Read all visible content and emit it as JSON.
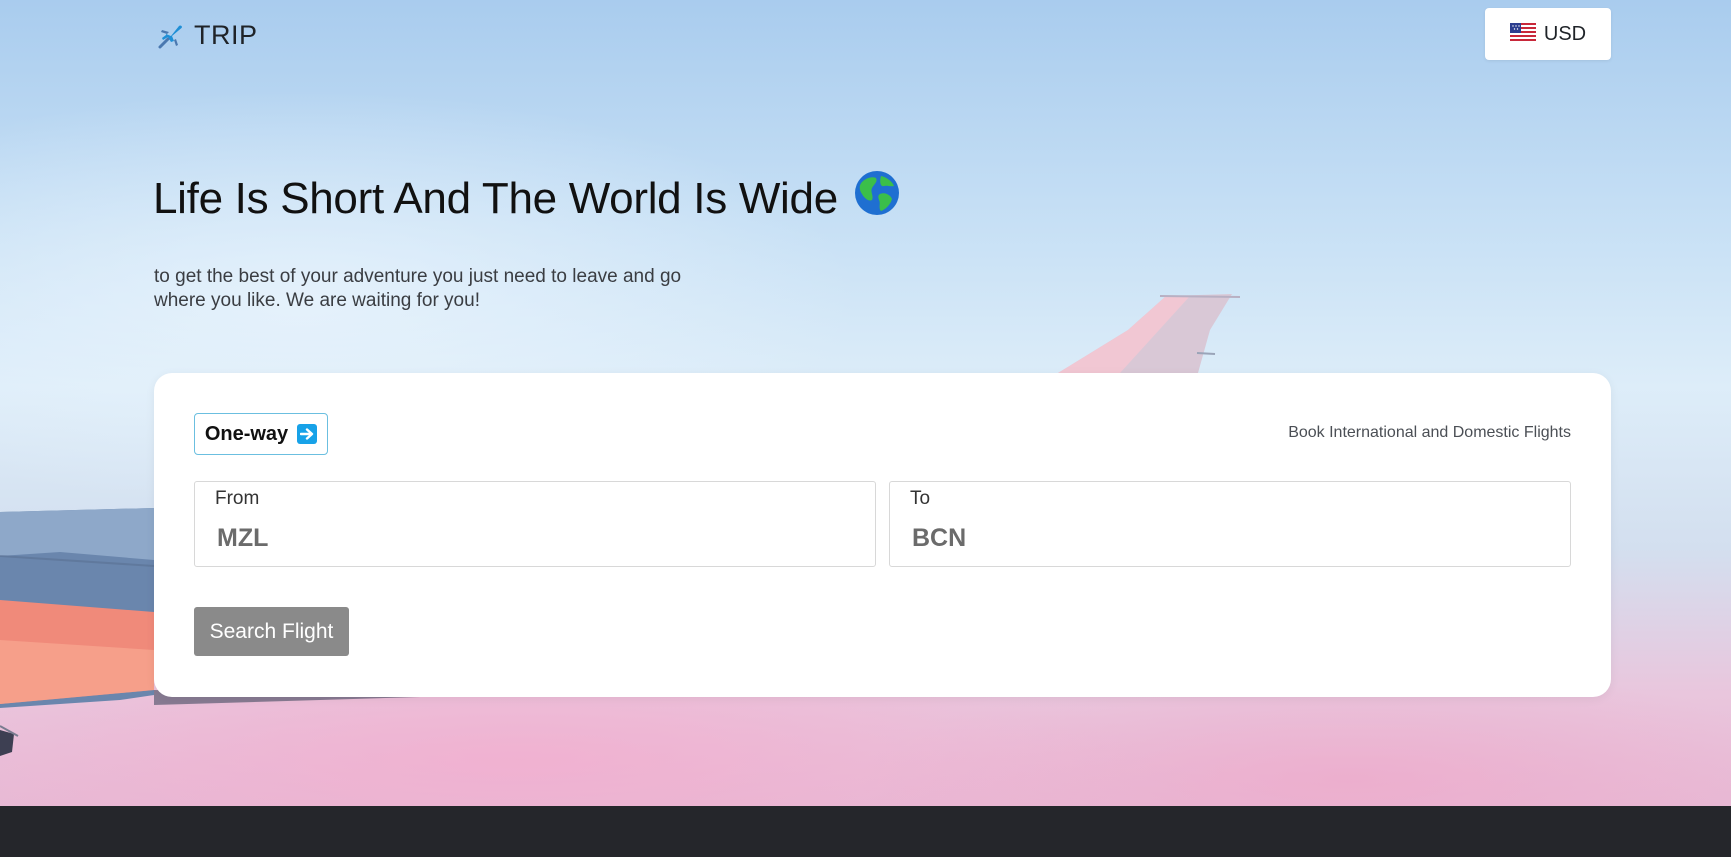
{
  "header": {
    "brand": "TRIP",
    "brand_icon": "airplane-icon",
    "currency": {
      "label": "USD",
      "flag_icon": "us-flag-icon"
    }
  },
  "hero": {
    "headline": "Life Is Short And The World Is Wide",
    "headline_emoji_icon": "globe-icon",
    "subtitle": "to get the best of your adventure you just need to leave and go where you like. We are waiting for you!"
  },
  "search": {
    "trip_type": "One-way",
    "trip_type_icon": "right-arrow-icon",
    "note": "Book International and Domestic Flights",
    "from_label": "From",
    "from_value": "MZL",
    "to_label": "To",
    "to_value": "BCN",
    "button_label": "Search Flight"
  },
  "colors": {
    "accent": "#17a2e8",
    "button": "#8a8a8a",
    "footer": "#25262b"
  }
}
